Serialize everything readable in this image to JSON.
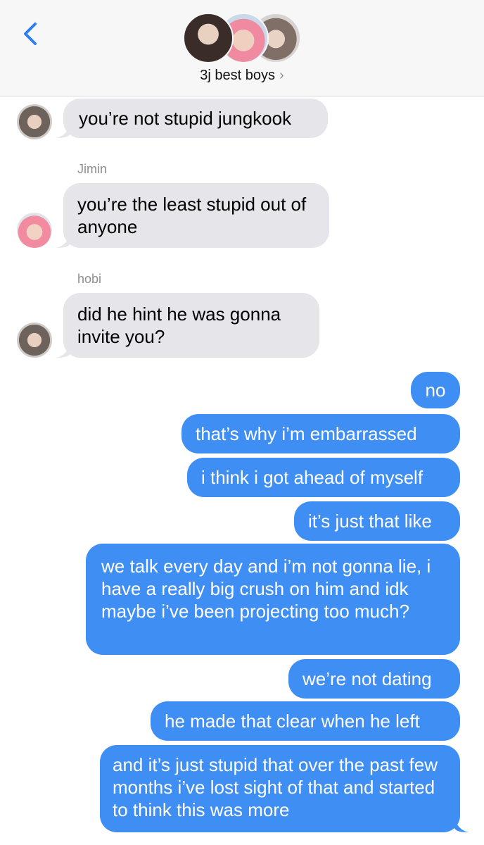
{
  "header": {
    "group_name": "3j best boys",
    "chevron": "›",
    "back_icon": "chevron-left-icon",
    "accent_color": "#2f7cf6"
  },
  "messages": [
    {
      "side": "in",
      "sender": "",
      "text": "you’re not stupid jungkook"
    },
    {
      "side": "in",
      "sender": "Jimin",
      "text": "you’re the least stupid out of anyone"
    },
    {
      "side": "in",
      "sender": "hobi",
      "text": "did he hint he was gonna invite you?"
    },
    {
      "side": "out",
      "text": "no"
    },
    {
      "side": "out",
      "text": "that’s why i’m embarrassed"
    },
    {
      "side": "out",
      "text": "i think i got ahead of myself"
    },
    {
      "side": "out",
      "text": "it’s just that like"
    },
    {
      "side": "out",
      "text": "we talk every day and i’m not gonna lie, i have a really big crush on him and idk maybe i’ve been projecting too much?"
    },
    {
      "side": "out",
      "text": "we’re not dating"
    },
    {
      "side": "out",
      "text": "he made that clear when he left"
    },
    {
      "side": "out",
      "text": "and it’s just stupid that over the past few months i’ve lost sight of that and started to think this was more"
    }
  ],
  "colors": {
    "incoming_bubble": "#e5e5ea",
    "outgoing_bubble": "#3f8ef4",
    "header_bg": "#f7f7f8"
  }
}
